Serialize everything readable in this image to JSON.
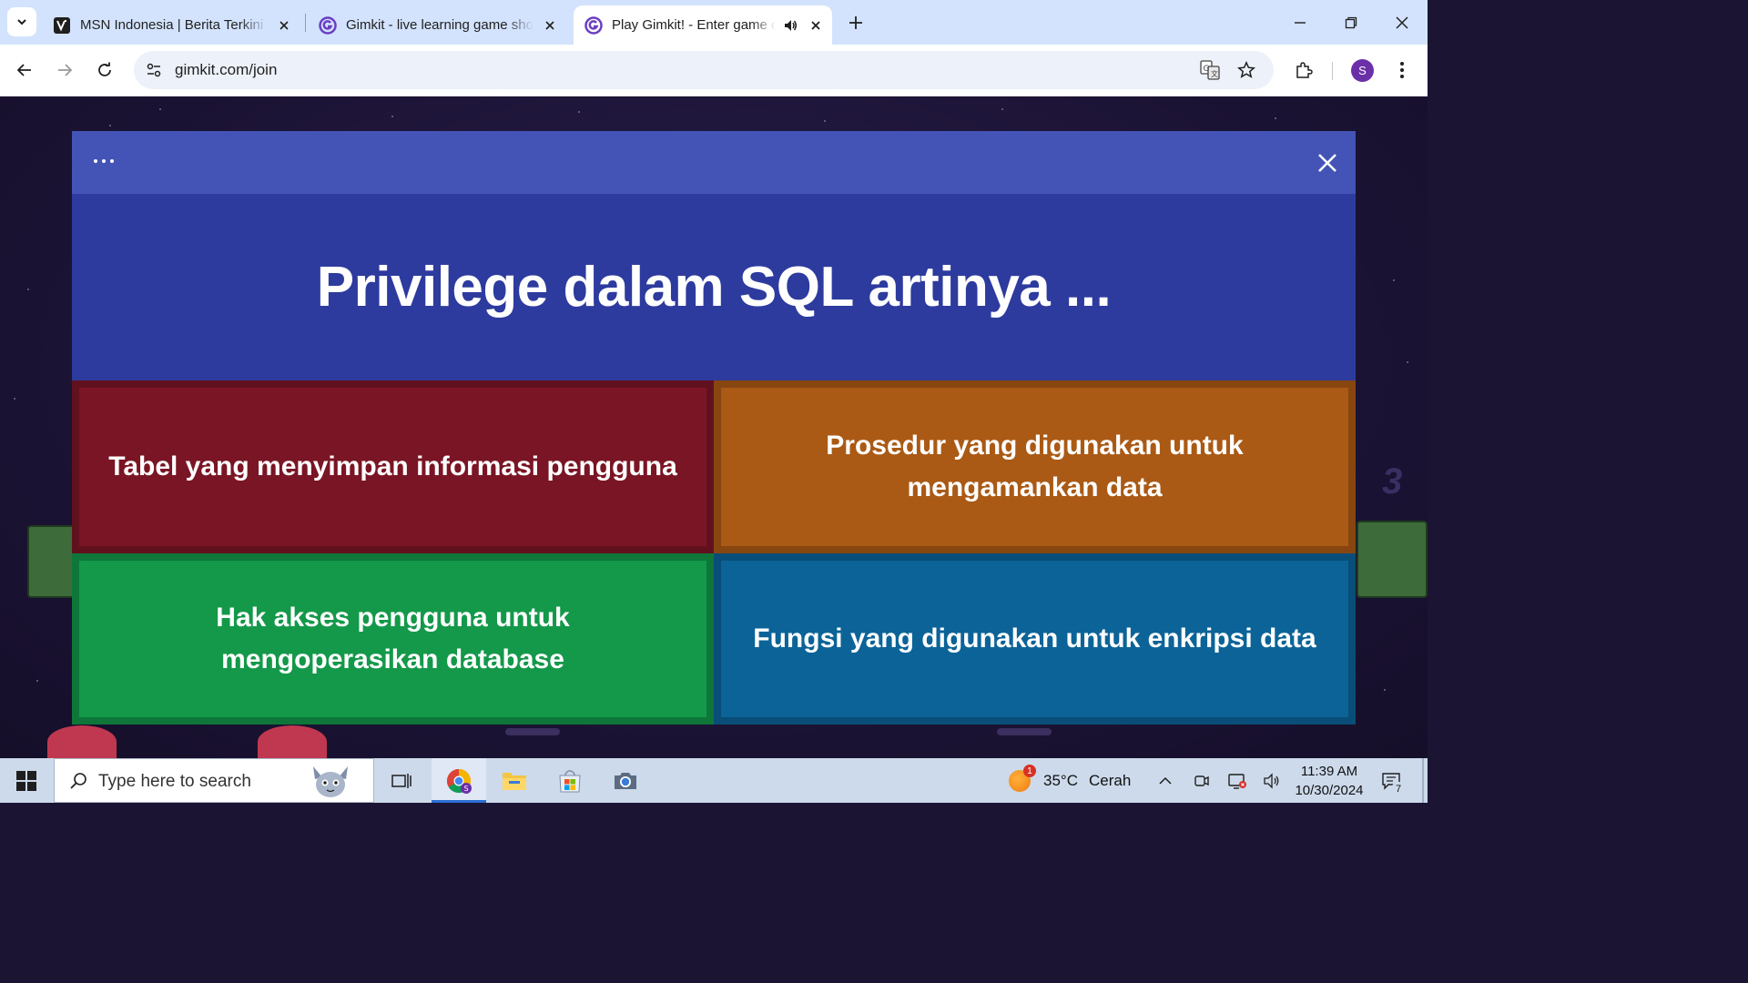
{
  "browser": {
    "tabs": [
      {
        "title": "MSN Indonesia | Berita Terkini Hari Ini",
        "favicon": "msn-icon",
        "active": false
      },
      {
        "title": "Gimkit - live learning game show",
        "favicon": "gimkit-icon",
        "active": false
      },
      {
        "title": "Play Gimkit! - Enter game code",
        "favicon": "gimkit-icon",
        "active": true,
        "audio": true
      }
    ],
    "address": {
      "url": "gimkit.com/join"
    },
    "profile_initial": "S",
    "icons": [
      "tab-search-icon",
      "back-icon",
      "forward-icon",
      "reload-icon",
      "site-info-icon",
      "translate-icon",
      "bookmark-star-icon",
      "extensions-icon",
      "menu-dots-icon",
      "minimize-icon",
      "restore-icon",
      "close-icon",
      "new-tab-icon",
      "speaker-icon"
    ]
  },
  "game": {
    "question": "Privilege dalam SQL artinya ...",
    "answers": [
      {
        "text": "Tabel yang menyimpan informasi pengguna",
        "color": "#7a1525"
      },
      {
        "text": "Prosedur yang digunakan untuk mengamankan data",
        "color": "#aa5a14"
      },
      {
        "text": "Hak akses pengguna untuk mengoperasikan database",
        "color": "#14984a"
      },
      {
        "text": "Fungsi yang digunakan untuk enkripsi data",
        "color": "#0b6397"
      }
    ],
    "background_number": "3",
    "colors": {
      "header": "#4354b6",
      "question_bg": "#2d3a9e"
    }
  },
  "taskbar": {
    "search_placeholder": "Type here to search",
    "weather": {
      "temp": "35°C",
      "condition": "Cerah",
      "badge": "1"
    },
    "clock": {
      "time": "11:39 AM",
      "date": "10/30/2024"
    },
    "notification_count": "7",
    "apps": [
      "task-view-icon",
      "chrome-icon",
      "file-explorer-icon",
      "microsoft-store-icon",
      "camera-icon"
    ]
  }
}
